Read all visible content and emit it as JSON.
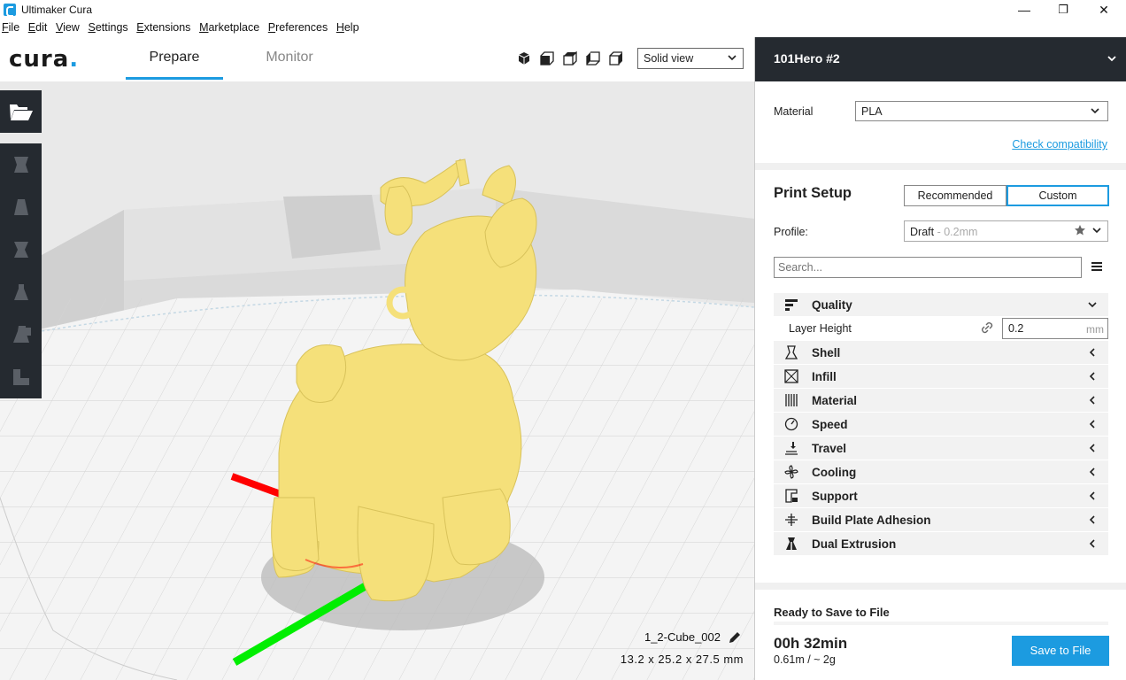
{
  "window": {
    "title": "Ultimaker Cura",
    "minimize": "—",
    "maximize": "❐",
    "close": "✕"
  },
  "menu": [
    "File",
    "Edit",
    "View",
    "Settings",
    "Extensions",
    "Marketplace",
    "Preferences",
    "Help"
  ],
  "toolbar": {
    "logo": "cura",
    "logo_dot": ".",
    "tabs": [
      "Prepare",
      "Monitor"
    ],
    "active_tab": "Prepare",
    "view_mode": "Solid view"
  },
  "viewport": {
    "object_name": "1_2-Cube_002",
    "dimensions": "13.2 x 25.2 x 27.5 mm"
  },
  "panel": {
    "printer_name": "101Hero #2",
    "material_label": "Material",
    "material_value": "PLA",
    "check_compatibility": "Check compatibility",
    "print_setup_title": "Print Setup",
    "mode_recommended": "Recommended",
    "mode_custom": "Custom",
    "profile_label": "Profile:",
    "profile_name": "Draft",
    "profile_detail": " - 0.2mm",
    "search_placeholder": "Search...",
    "categories": [
      {
        "label": "Quality",
        "icon": "quality-icon",
        "expanded": true
      },
      {
        "label": "Shell",
        "icon": "shell-icon"
      },
      {
        "label": "Infill",
        "icon": "infill-icon"
      },
      {
        "label": "Material",
        "icon": "material-icon"
      },
      {
        "label": "Speed",
        "icon": "speed-icon"
      },
      {
        "label": "Travel",
        "icon": "travel-icon"
      },
      {
        "label": "Cooling",
        "icon": "cooling-icon"
      },
      {
        "label": "Support",
        "icon": "support-icon"
      },
      {
        "label": "Build Plate Adhesion",
        "icon": "build-plate-icon"
      },
      {
        "label": "Dual Extrusion",
        "icon": "dual-extrusion-icon"
      }
    ],
    "layer_height": {
      "label": "Layer Height",
      "value": "0.2",
      "unit": "mm"
    },
    "save_status": "Ready to Save to File",
    "print_time": "00h 32min",
    "print_usage": "0.61m / ~ 2g",
    "save_button": "Save to File"
  },
  "colors": {
    "accent": "#1c9be0",
    "dark": "#252a30",
    "model": "#f5e07a",
    "axis_x": "#ff0000",
    "axis_y": "#00ee00",
    "axis_z": "#0000ff"
  }
}
